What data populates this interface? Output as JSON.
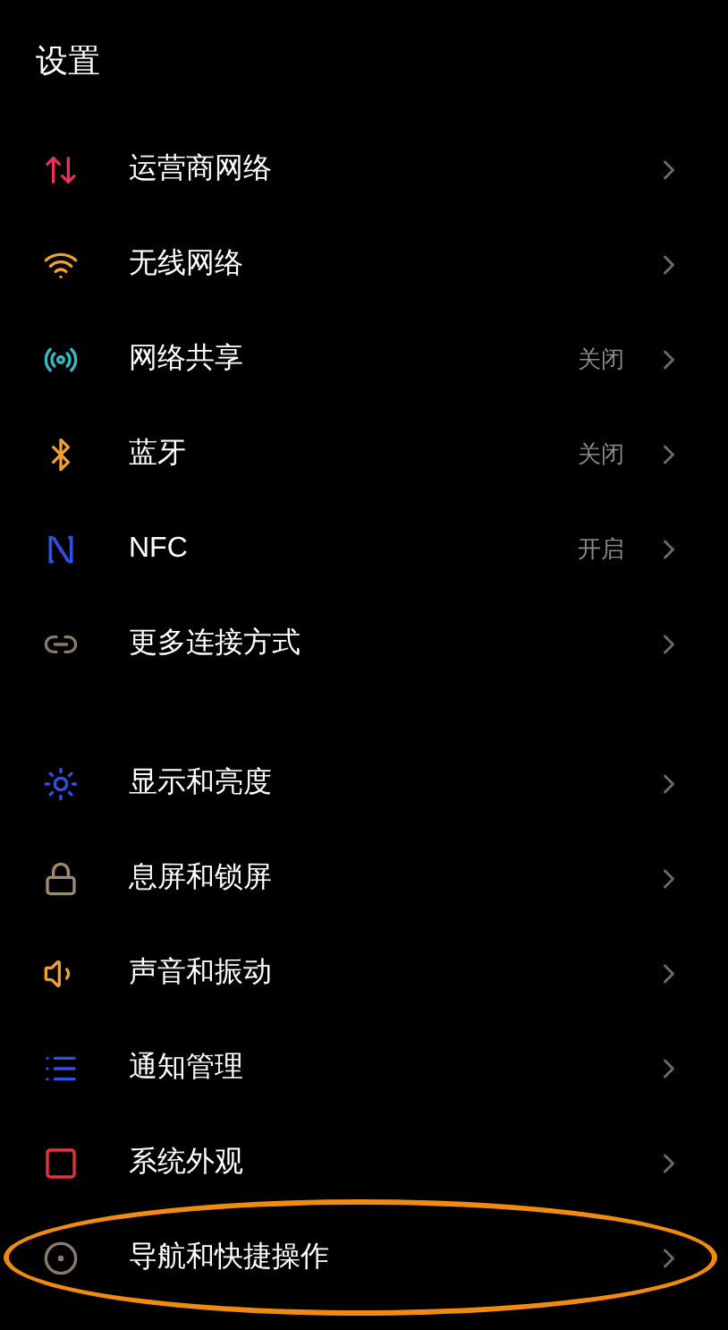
{
  "title": "设置",
  "groups": [
    {
      "items": [
        {
          "label": "运营商网络",
          "color": "#e8305a",
          "highlighted": false
        },
        {
          "label": "无线网络",
          "color": "#f0a030",
          "highlighted": false
        },
        {
          "label": "网络共享",
          "value": "关闭",
          "color": "#3ab8c0",
          "highlighted": false
        },
        {
          "label": "蓝牙",
          "value": "关闭",
          "color": "#f0a030",
          "highlighted": false
        },
        {
          "label": "NFC",
          "value": "开启",
          "color": "#3050e0",
          "highlighted": false
        },
        {
          "label": "更多连接方式",
          "color": "#8a7a6a",
          "highlighted": false
        }
      ]
    },
    {
      "items": [
        {
          "label": "显示和亮度",
          "color": "#3050e0",
          "highlighted": false
        },
        {
          "label": "息屏和锁屏",
          "color": "#a08a70",
          "highlighted": false
        },
        {
          "label": "声音和振动",
          "color": "#f0a030",
          "highlighted": false
        },
        {
          "label": "通知管理",
          "color": "#3050e0",
          "highlighted": false
        },
        {
          "label": "系统外观",
          "color": "#e83040",
          "highlighted": false
        },
        {
          "label": "导航和快捷操作",
          "color": "#8a7a6a",
          "highlighted": true
        }
      ]
    }
  ]
}
